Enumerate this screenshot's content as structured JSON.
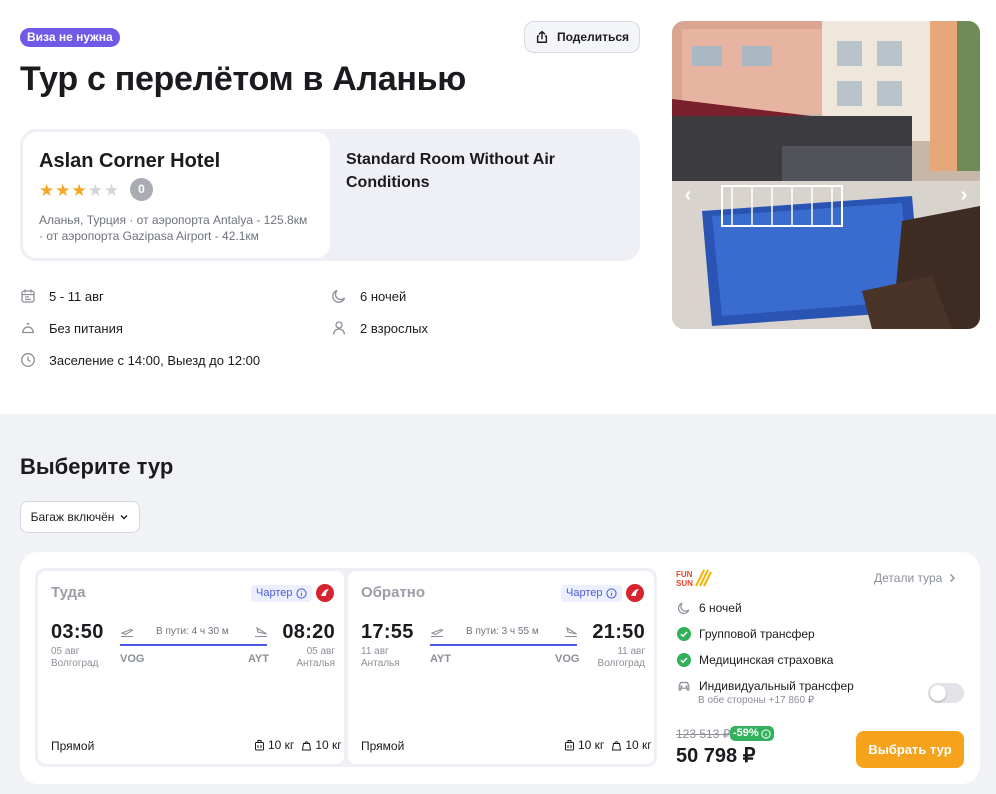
{
  "header": {
    "visa_badge": "Виза не нужна",
    "share_label": "Поделиться",
    "title": "Тур с перелётом в Аланью"
  },
  "hotel": {
    "name": "Aslan Corner Hotel",
    "stars": 3,
    "max_stars": 5,
    "rating": "0",
    "location_line1": "Аланья, Турция · от аэропорта Antalya - 125.8км",
    "location_line2": "· от аэропорта Gazipasa Airport - 42.1км",
    "room": "Standard Room Without Air Conditions"
  },
  "trip_info": {
    "dates": "5 - 11 авг",
    "nights": "6 ночей",
    "meal": "Без питания",
    "guests": "2 взрослых",
    "checkin": "Заселение с 14:00, Выезд до 12:00"
  },
  "gallery": {
    "prev_icon": "chevron-left-icon",
    "next_icon": "chevron-right-icon"
  },
  "tour_section": {
    "title": "Выберите тур",
    "filter_label": "Багаж включён"
  },
  "offer": {
    "outbound": {
      "label": "Туда",
      "charter": "Чартер",
      "dep_time": "03:50",
      "dep_date": "05 авг",
      "dep_city": "Волгоград",
      "dep_code": "VOG",
      "duration": "В пути: 4 ч 30 м",
      "arr_time": "08:20",
      "arr_date": "05 авг",
      "arr_city": "Анталья",
      "arr_code": "AYT",
      "type": "Прямой",
      "bag1": "10 кг",
      "bag2": "10 кг"
    },
    "return": {
      "label": "Обратно",
      "charter": "Чартер",
      "dep_time": "17:55",
      "dep_date": "11 авг",
      "dep_city": "Анталья",
      "dep_code": "AYT",
      "duration": "В пути: 3 ч 55 м",
      "arr_time": "21:50",
      "arr_date": "11 авг",
      "arr_city": "Волгоград",
      "arr_code": "VOG",
      "type": "Прямой",
      "bag1": "10 кг",
      "bag2": "10 кг"
    },
    "operator_logo": "FUN SUN",
    "details_link": "Детали тура",
    "features": {
      "nights": "6 ночей",
      "transfer": "Групповой трансфер",
      "insurance": "Медицинская страховка",
      "individual_transfer": "Индивидуальный трансфер",
      "individual_transfer_sub": "В обе стороны +17 860 ₽"
    },
    "old_price": "123 513 ₽",
    "discount": "-59%",
    "price": "50 798 ₽",
    "select_button": "Выбрать тур"
  },
  "colors": {
    "accent_purple": "#6e5ae6",
    "route_blue": "#4d5be0",
    "orange_button": "#f7a21b",
    "discount_green": "#33b05c",
    "star": "#f5a623",
    "airline_red": "#d7232f"
  }
}
